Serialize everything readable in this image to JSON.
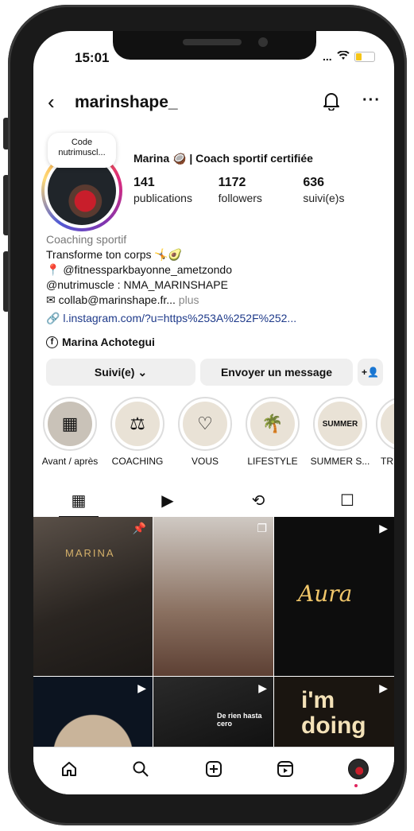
{
  "status_bar": {
    "time": "15:01",
    "signal": "...",
    "wifi": "wifi-icon"
  },
  "header": {
    "username": "marinshape_"
  },
  "note": {
    "text": "Code nutrimuscl..."
  },
  "profile": {
    "display_name": "Marina 🥥 | Coach sportif certifiée",
    "stats": [
      {
        "num": "141",
        "label": "publications"
      },
      {
        "num": "1172",
        "label": "followers"
      },
      {
        "num": "636",
        "label": "suivi(e)s"
      }
    ]
  },
  "bio": {
    "category": "Coaching sportif",
    "line1": "Transforme ton corps 🤸🥑",
    "line2": "📍 @fitnessparkbayonne_ametzondo",
    "line3": "@nutrimuscle : NMA_MARINSHAPE",
    "line4": "collab@marinshape.fr...",
    "more": "plus",
    "link": "l.instagram.com/?u=https%253A%252F%252...",
    "facebook_name": "Marina Achotegui"
  },
  "buttons": {
    "following": "Suivi(e) ⌄",
    "message": "Envoyer un message",
    "add": "+👤"
  },
  "highlights": [
    {
      "label": "Avant / après",
      "glyph": "▦"
    },
    {
      "label": "COACHING",
      "glyph": "⚖"
    },
    {
      "label": "VOUS",
      "glyph": "♡"
    },
    {
      "label": "LIFESTYLE",
      "glyph": "🌴"
    },
    {
      "label": "SUMMER S...",
      "glyph": "SUMMER"
    },
    {
      "label": "TR",
      "glyph": ""
    }
  ],
  "posts": [
    {
      "overlay": "MARINA",
      "badge": "📌"
    },
    {
      "overlay": "",
      "badge": "❐"
    },
    {
      "overlay": "Aura",
      "badge": "▶"
    },
    {
      "overlay": "",
      "badge": "▶"
    },
    {
      "overlay": "De rien hasta cero",
      "badge": "▶"
    },
    {
      "overlay": "i'm doing",
      "badge": "▶"
    }
  ],
  "colors": {
    "link": "#1e3a8a",
    "button_bg": "#efefef",
    "accent_dot": "#e0245e"
  }
}
